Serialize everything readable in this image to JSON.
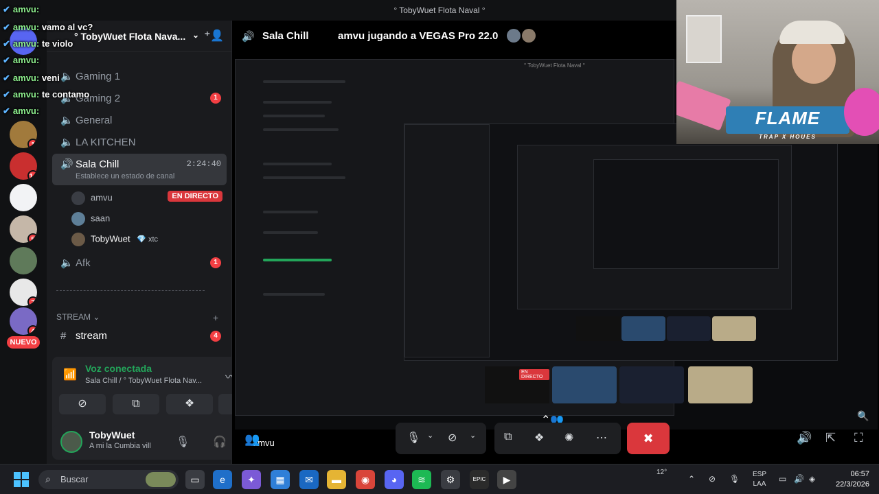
{
  "window": {
    "title": "° TobyWuet Flota Naval °"
  },
  "chat_overlay": [
    {
      "user": "amvu:",
      "text": ""
    },
    {
      "user": "amvu:",
      "text": "vamo al vc?"
    },
    {
      "user": "amvu:",
      "text": "te violo"
    },
    {
      "user": "amvu:",
      "text": ""
    },
    {
      "user": "amvu:",
      "text": "veni"
    },
    {
      "user": "amvu:",
      "text": "te contamo"
    },
    {
      "user": "amvu:",
      "text": ""
    }
  ],
  "rail": {
    "servers": [
      {
        "badge": ""
      },
      {
        "badge": "1"
      },
      {
        "badge": "14"
      },
      {
        "badge": ""
      },
      {
        "badge": "5"
      },
      {
        "badge": ""
      },
      {
        "badge": "7"
      },
      {
        "badge": "4"
      }
    ],
    "new_label": "NUEVO"
  },
  "sidebar": {
    "server_name": "° TobyWuet Flota Nava...",
    "channels": [
      {
        "icon": "speaker",
        "name": "Gaming 1",
        "count": ""
      },
      {
        "icon": "speaker",
        "name": "Gaming 2",
        "count": "1"
      },
      {
        "icon": "speaker",
        "name": "General",
        "count": ""
      },
      {
        "icon": "speaker",
        "name": "LA KITCHEN",
        "count": ""
      }
    ],
    "active_channel": {
      "name": "Sala Chill",
      "timer": "2:24:40",
      "status": "Establece un estado de canal"
    },
    "voice_users": [
      {
        "name": "amvu",
        "live": "EN DIRECTO",
        "tag": ""
      },
      {
        "name": "saan",
        "live": "",
        "tag": ""
      },
      {
        "name": "TobyWuet",
        "live": "",
        "tag": "xtc"
      }
    ],
    "afk": {
      "name": "Afk",
      "count": "1"
    },
    "category": "STREAM",
    "stream_channel": {
      "name": "stream",
      "count": "4"
    }
  },
  "voice_panel": {
    "title": "Voz conectada",
    "subtitle": "Sala Chill / ° TobyWuet Flota Nav..."
  },
  "user": {
    "name": "TobyWuet",
    "status": "A mi la Cumbia vill"
  },
  "stage": {
    "channel": "Sala Chill",
    "activity": "amvu jugando a VEGAS Pro 22.0",
    "streamer_label": "amvu",
    "nested_title": "° TobyWuet Flota Naval °",
    "nested_live": "EN DIRECTO"
  },
  "webcam": {
    "logo": "FLAME",
    "logo_sub": "TRAP X HOUES"
  },
  "taskbar": {
    "search_placeholder": "Buscar",
    "temp": "12°",
    "lang1": "ESP",
    "lang2": "LAA",
    "time": "06:57",
    "date": "22/3/2026"
  },
  "colors": {
    "live_red": "#da373c",
    "connected_green": "#23a55a",
    "bg": "#1a1b1e"
  }
}
